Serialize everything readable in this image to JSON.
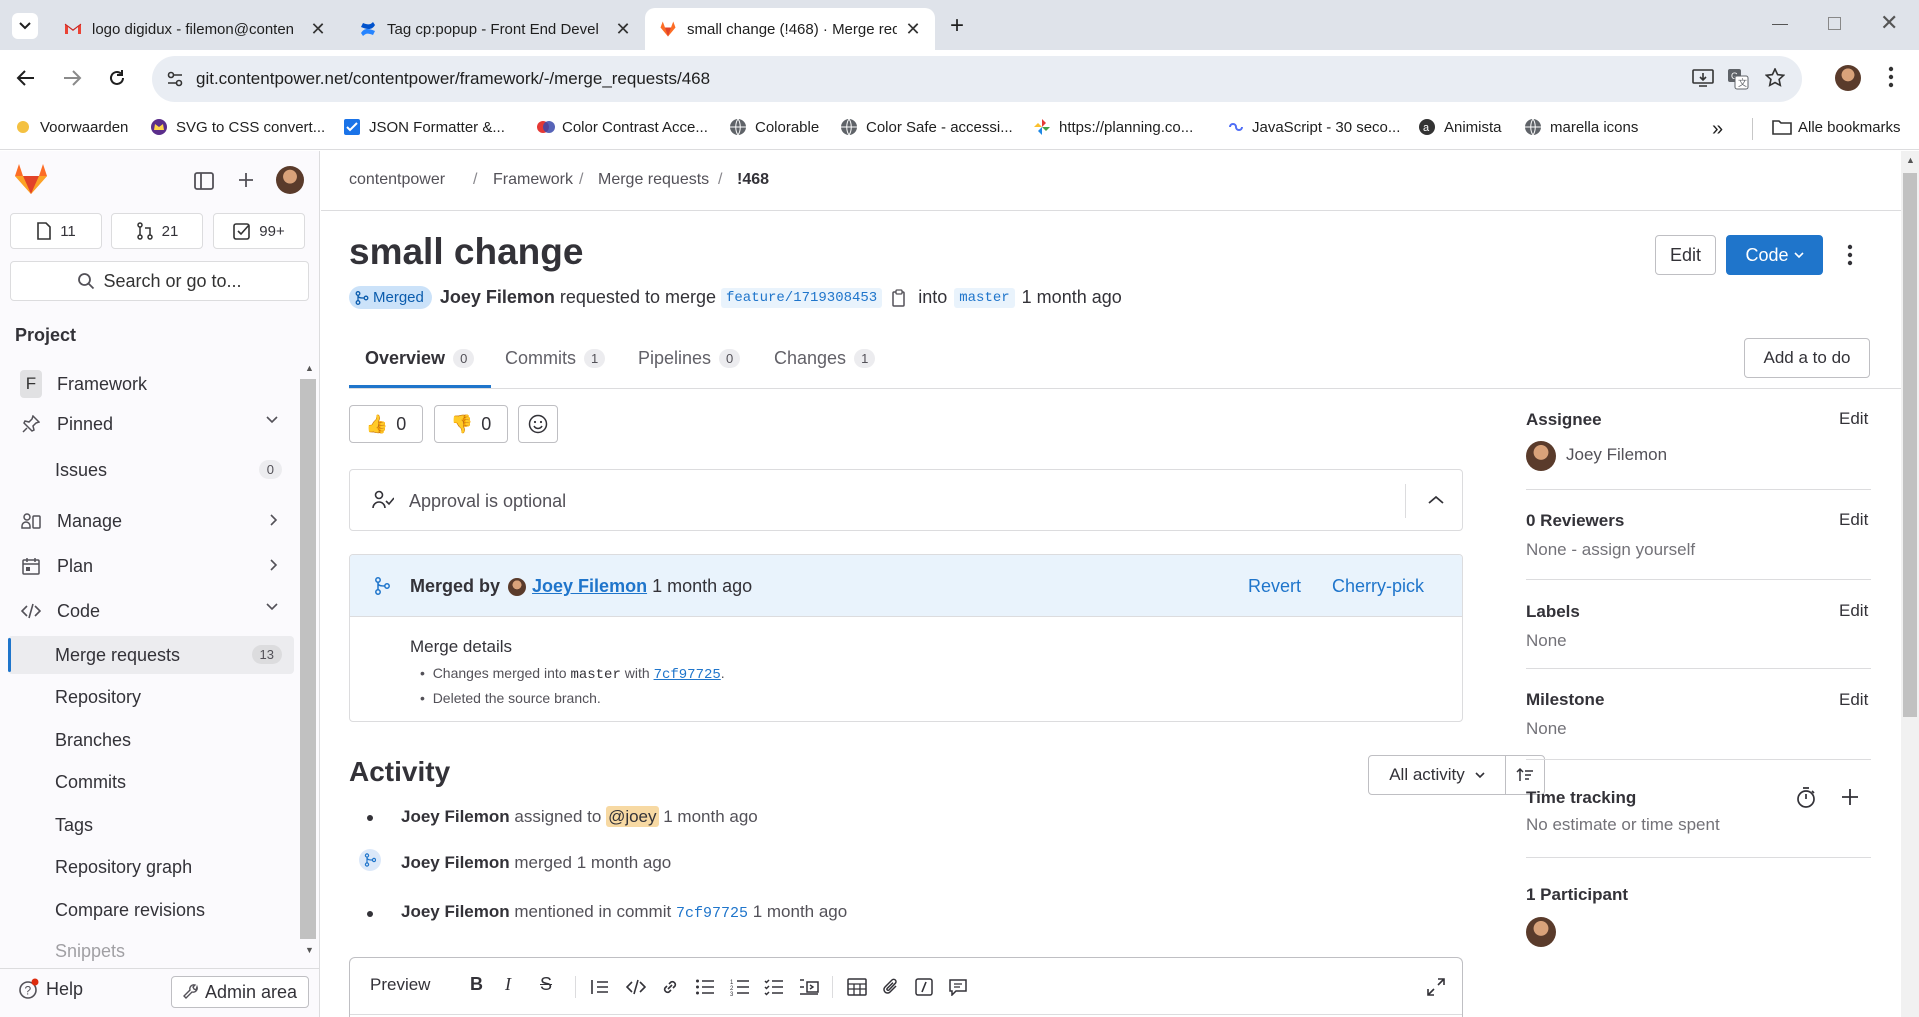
{
  "browser": {
    "tabs": [
      {
        "title": "logo digidux - filemon@conten",
        "icon": "gmail-icon"
      },
      {
        "title": "Tag cp:popup - Front End Devel",
        "icon": "confluence-icon"
      },
      {
        "title": "small change (!468) · Merge req",
        "icon": "gitlab-icon"
      }
    ],
    "url": "git.contentpower.net/contentpower/framework/-/merge_requests/468",
    "bookmarks": [
      "Voorwaarden",
      "SVG to CSS convert...",
      "JSON Formatter &...",
      "Color Contrast Acce...",
      "Colorable",
      "Color Safe - accessi...",
      "https://planning.co...",
      "JavaScript - 30 seco...",
      "Animista",
      "marella icons"
    ],
    "all_bookmarks": "Alle bookmarks"
  },
  "sidebar": {
    "counts": {
      "issues": "11",
      "merge_requests": "21",
      "todos": "99+"
    },
    "search_label": "Search or go to...",
    "section_title": "Project",
    "project": {
      "letter": "F",
      "name": "Framework"
    },
    "pinned": "Pinned",
    "issues": {
      "label": "Issues",
      "count": "0"
    },
    "manage": "Manage",
    "plan": "Plan",
    "code": "Code",
    "merge_requests": {
      "label": "Merge requests",
      "count": "13"
    },
    "code_items": [
      "Repository",
      "Branches",
      "Commits",
      "Tags",
      "Repository graph",
      "Compare revisions",
      "Snippets"
    ],
    "help": "Help",
    "admin": "Admin area"
  },
  "breadcrumb": [
    "contentpower",
    "Framework",
    "Merge requests",
    "!468"
  ],
  "mr": {
    "title": "small change",
    "status": "Merged",
    "author": "Joey Filemon",
    "requested_text": "requested to merge",
    "source_branch": "feature/1719308453",
    "into_text": "into",
    "target_branch": "master",
    "time": "1 month ago",
    "edit_label": "Edit",
    "code_label": "Code"
  },
  "tabs": [
    {
      "label": "Overview",
      "count": "0"
    },
    {
      "label": "Commits",
      "count": "1"
    },
    {
      "label": "Pipelines",
      "count": "0"
    },
    {
      "label": "Changes",
      "count": "1"
    }
  ],
  "add_todo": "Add a to do",
  "reactions": {
    "thumbsup": "0",
    "thumbsdown": "0"
  },
  "approval": "Approval is optional",
  "merged_box": {
    "merged_by": "Merged by",
    "user": "Joey Filemon",
    "time": "1 month ago",
    "revert": "Revert",
    "cherry_pick": "Cherry-pick",
    "details_title": "Merge details",
    "detail1_pre": "Changes merged into",
    "detail1_branch": "master",
    "detail1_with": "with",
    "detail1_commit": "7cf97725",
    "detail1_end": ".",
    "detail2": "Deleted the source branch."
  },
  "activity": {
    "title": "Activity",
    "filter": "All activity",
    "items": [
      {
        "user": "Joey Filemon",
        "text": "assigned to",
        "mention": "@joey",
        "time": "1 month ago"
      },
      {
        "user": "Joey Filemon",
        "text": "merged",
        "time": "1 month ago"
      },
      {
        "user": "Joey Filemon",
        "text": "mentioned in commit",
        "commit": "7cf97725",
        "time": "1 month ago"
      }
    ]
  },
  "editor": {
    "preview": "Preview"
  },
  "right": {
    "assignee_title": "Assignee",
    "assignee": "Joey Filemon",
    "reviewers_title": "0 Reviewers",
    "reviewers_value": "None - assign yourself",
    "labels_title": "Labels",
    "labels_value": "None",
    "milestone_title": "Milestone",
    "milestone_value": "None",
    "time_title": "Time tracking",
    "time_value": "No estimate or time spent",
    "participants_title": "1 Participant",
    "edit": "Edit"
  },
  "colors": {
    "accent": "#1f75cb",
    "merged": "#dbe8f9",
    "tabbar": "#dfe3ea"
  }
}
